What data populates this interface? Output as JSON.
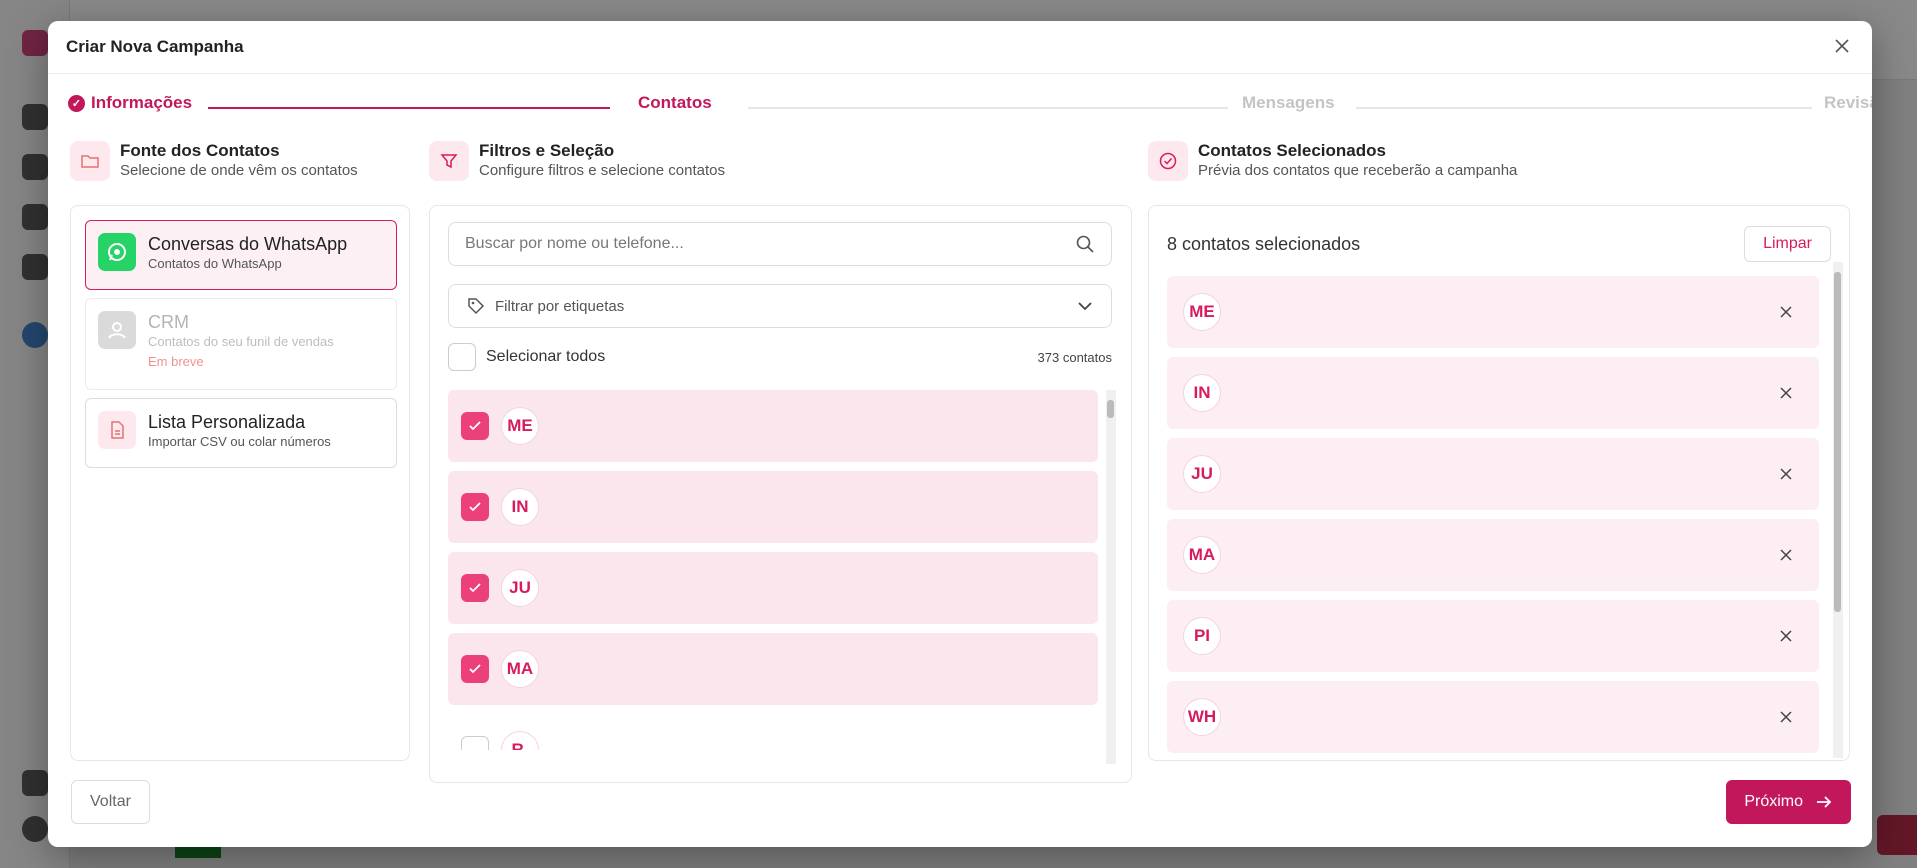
{
  "modal": {
    "title": "Criar Nova Campanha"
  },
  "stepper": {
    "steps": [
      {
        "label": "Informações",
        "state": "done"
      },
      {
        "label": "Contatos",
        "state": "active"
      },
      {
        "label": "Mensagens",
        "state": "inactive"
      },
      {
        "label": "Revisão",
        "state": "inactive"
      }
    ]
  },
  "source": {
    "title": "Fonte dos Contatos",
    "subtitle": "Selecione de onde vêm os contatos",
    "options": [
      {
        "title": "Conversas do WhatsApp",
        "subtitle": "Contatos do WhatsApp",
        "badge": "",
        "icon": "whatsapp-icon"
      },
      {
        "title": "CRM",
        "subtitle": "Contatos do seu funil de vendas",
        "badge": "Em breve",
        "icon": "crm-icon"
      },
      {
        "title": "Lista Personalizada",
        "subtitle": "Importar CSV ou colar números",
        "badge": "",
        "icon": "file-icon"
      }
    ]
  },
  "filters": {
    "title": "Filtros e Seleção",
    "subtitle": "Configure filtros e selecione contatos",
    "search_placeholder": "Buscar por nome ou telefone...",
    "tag_filter_label": "Filtrar por etiquetas",
    "select_all_label": "Selecionar todos",
    "total_count": "373 contatos",
    "contacts": [
      {
        "initials": "ME",
        "checked": true
      },
      {
        "initials": "IN",
        "checked": true
      },
      {
        "initials": "JU",
        "checked": true
      },
      {
        "initials": "MA",
        "checked": true
      },
      {
        "initials": "R.",
        "checked": false
      }
    ]
  },
  "selected": {
    "title": "Contatos Selecionados",
    "subtitle": "Prévia dos contatos que receberão a campanha",
    "count_label": "8 contatos selecionados",
    "clear_label": "Limpar",
    "contacts": [
      "ME",
      "IN",
      "JU",
      "MA",
      "PI",
      "WH"
    ]
  },
  "footer": {
    "back_label": "Voltar",
    "next_label": "Próximo"
  },
  "colors": {
    "accent": "#c2185b",
    "checkbox": "#ec407a",
    "whatsapp": "#25d366"
  }
}
